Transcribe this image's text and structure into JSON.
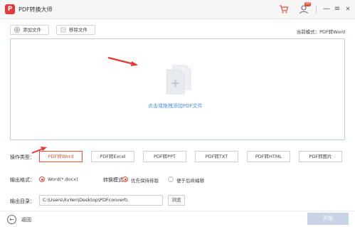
{
  "titlebar": {
    "logo": "P",
    "title": "PDF转换大师",
    "user_badge": "VIP",
    "min_label": "—",
    "menu_label": "≡",
    "close_label": "✕"
  },
  "toolbar": {
    "add_file": "添加文件",
    "remove_file": "移除文件",
    "mode": "当前模式：PDF转Word"
  },
  "dropzone": {
    "text": "点击或拖拽添加PDF文件"
  },
  "operation": {
    "label": "操作类型：",
    "tabs": [
      {
        "label": "PDF转Word",
        "active": true
      },
      {
        "label": "PDF转Excel",
        "active": false
      },
      {
        "label": "PDF转PPT",
        "active": false
      },
      {
        "label": "PDF转TXT",
        "active": false
      },
      {
        "label": "PDF转HTML",
        "active": false
      },
      {
        "label": "PDF转图片",
        "active": false
      }
    ]
  },
  "output_format": {
    "label": "输出格式：",
    "option": "Word(*.docx)"
  },
  "convert_mode": {
    "label": "转换模式：",
    "options": [
      {
        "label": "优先保持排版",
        "selected": true
      },
      {
        "label": "便于后续编辑",
        "selected": false
      }
    ]
  },
  "output_dir": {
    "label": "输出目录：",
    "value": "C:\\Users\\XvYen\\Desktop\\PDFconvert\\",
    "browse": "浏览"
  },
  "footer": {
    "back": "返回",
    "start": "开始"
  },
  "colors": {
    "accent": "#e94e3c",
    "link": "#4a90e2",
    "start_disabled": "#c9d3e6"
  }
}
